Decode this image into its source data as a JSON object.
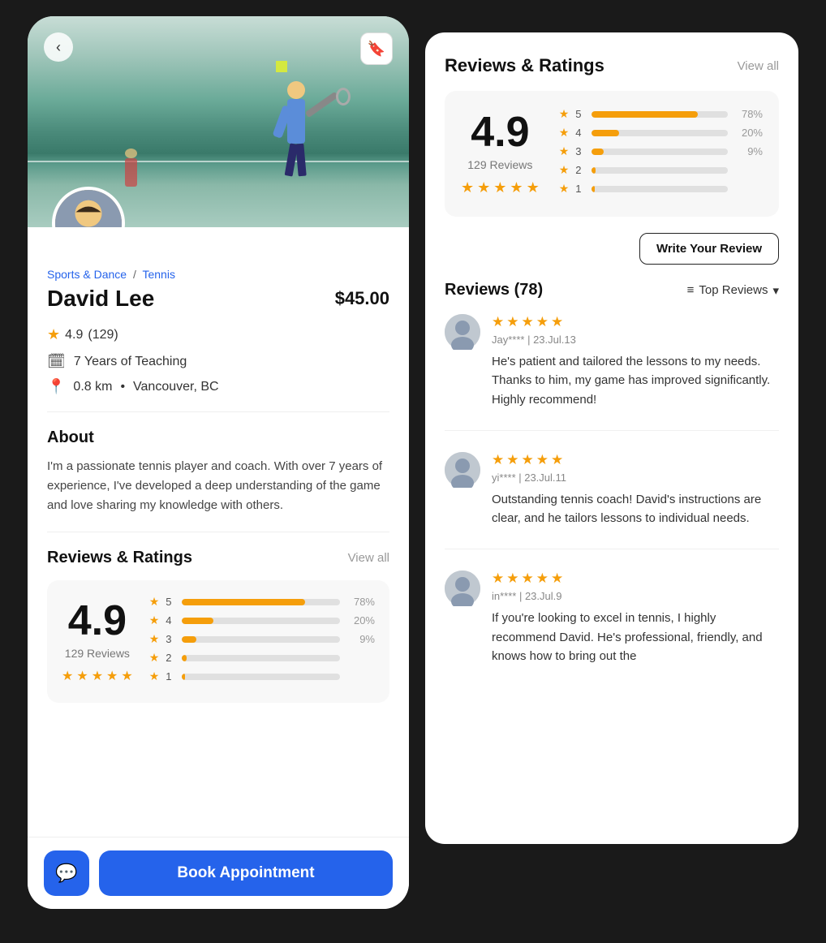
{
  "leftPanel": {
    "backButton": "‹",
    "breadcrumb": {
      "sports": "Sports & Dance",
      "separator": "/",
      "tennis": "Tennis"
    },
    "coachName": "David Lee",
    "price": "$45.00",
    "rating": "4.9",
    "ratingCount": "(129)",
    "years": "7 Years of Teaching",
    "distance": "0.8 km",
    "location": "Vancouver, BC",
    "aboutTitle": "About",
    "aboutText": "I'm a passionate tennis player and coach. With over 7 years of experience, I've developed a deep understanding of the game and love sharing my knowledge with others.",
    "reviewsTitle": "Reviews & Ratings",
    "viewAll": "View all",
    "bigRating": "4.9",
    "ratingSubtitle": "129 Reviews",
    "bars": [
      {
        "star": "5",
        "pct": 78,
        "label": "78%"
      },
      {
        "star": "4",
        "pct": 20,
        "label": "20%"
      },
      {
        "star": "3",
        "pct": 9,
        "label": "9%"
      },
      {
        "star": "2",
        "pct": 3,
        "label": ""
      },
      {
        "star": "1",
        "pct": 2,
        "label": ""
      }
    ],
    "chatBtnIcon": "💬",
    "bookBtnLabel": "Book Appointment"
  },
  "rightPanel": {
    "title": "Reviews & Ratings",
    "viewAll": "View all",
    "bigRating": "4.9",
    "ratingSubtitle": "129 Reviews",
    "bars": [
      {
        "star": "5",
        "pct": 78,
        "label": "78%"
      },
      {
        "star": "4",
        "pct": 20,
        "label": "20%"
      },
      {
        "star": "3",
        "pct": 9,
        "label": "9%"
      },
      {
        "star": "2",
        "pct": 3,
        "label": ""
      },
      {
        "star": "1",
        "pct": 2,
        "label": ""
      }
    ],
    "writeReviewLabel": "Write Your Review",
    "reviewsCountLabel": "Reviews (78)",
    "topReviewsLabel": "Top Reviews",
    "reviews": [
      {
        "name": "Jay**** | 23.Jul.13",
        "stars": 5,
        "text": "He's patient and tailored the lessons to my needs. Thanks to him, my game has improved significantly. Highly recommend!"
      },
      {
        "name": "yi**** | 23.Jul.11",
        "stars": 5,
        "text": "Outstanding tennis coach! David's instructions are clear, and he tailors lessons to individual needs."
      },
      {
        "name": "in**** | 23.Jul.9",
        "stars": 5,
        "text": "If you're looking to excel in tennis, I highly recommend David. He's professional, friendly, and knows how to bring out the"
      }
    ]
  }
}
